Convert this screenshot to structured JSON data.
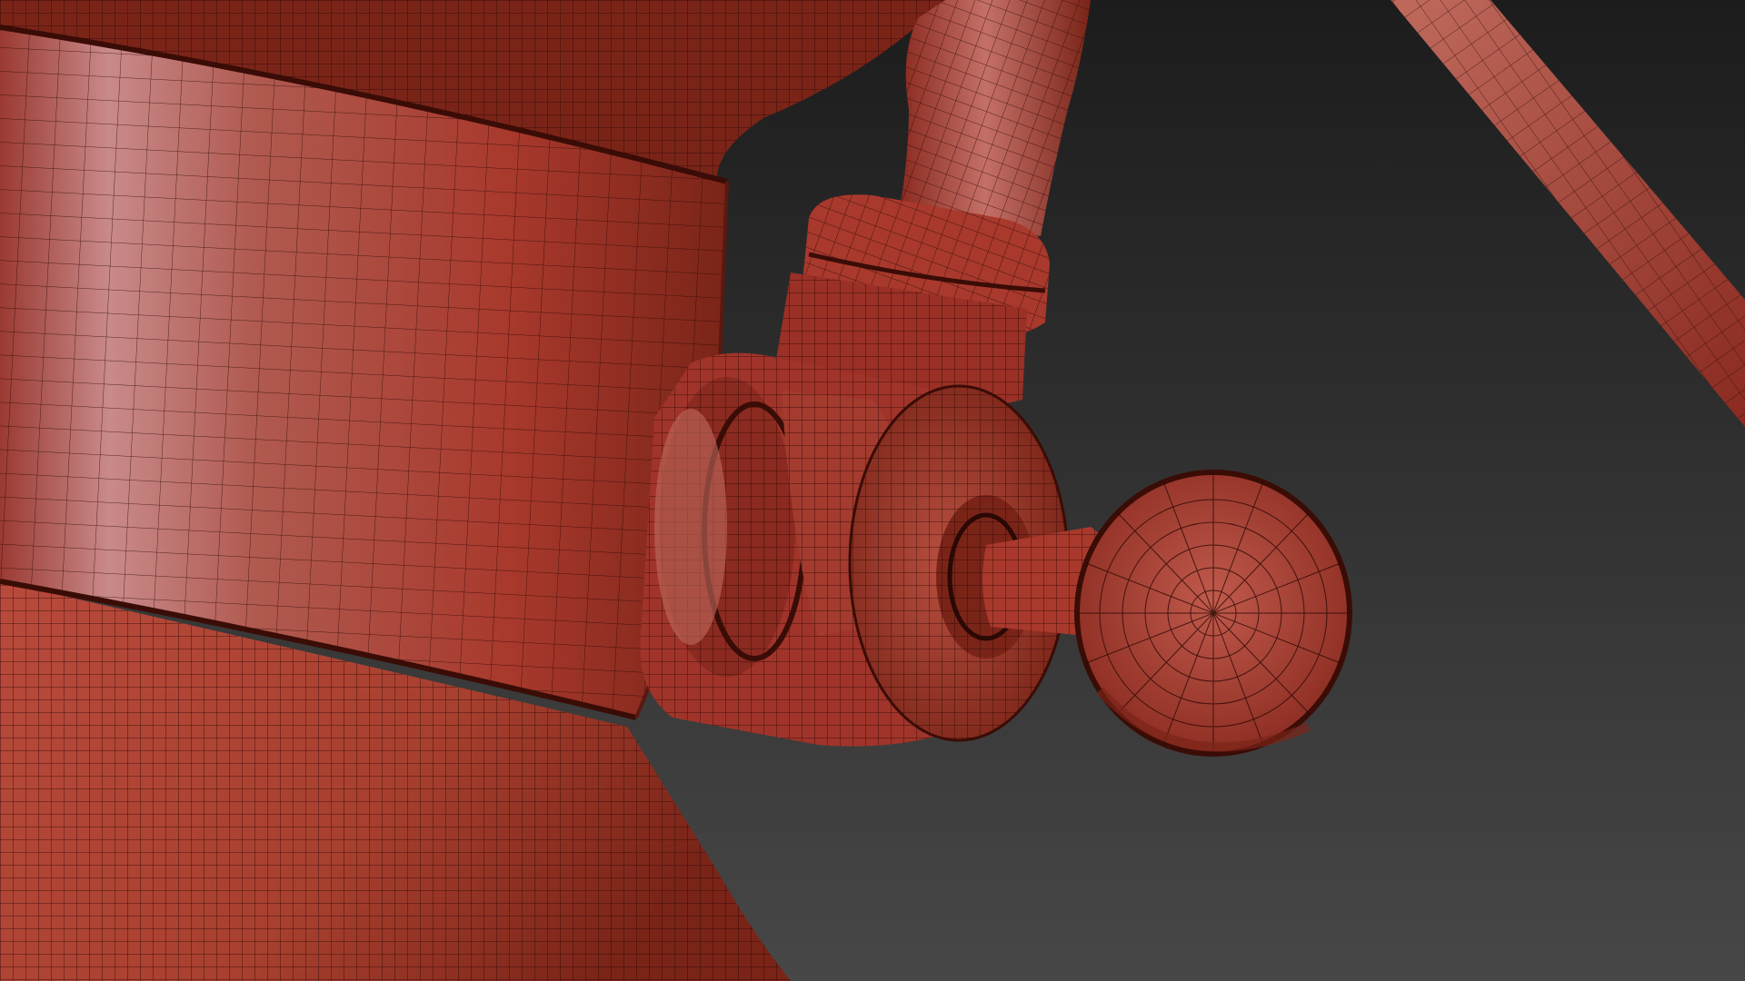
{
  "scene": {
    "subject": "fire-extinguisher-valve-wireframe",
    "background_top": "#1c1c1c",
    "background_bottom": "#474747",
    "mesh_base": "#b84a3c",
    "mesh_dark": "#6e2118",
    "mesh_highlight": "#c98a8a",
    "wire_color": "#2a0804"
  }
}
